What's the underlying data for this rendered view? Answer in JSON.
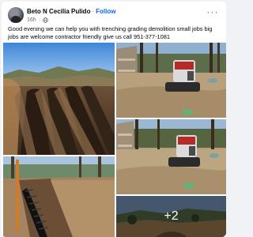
{
  "post": {
    "author": "Beto N Cecilia Pulido",
    "separator": "·",
    "follow_label": "Follow",
    "time": "16h",
    "time_separator": "·",
    "caption": "Good evening we can help you with trenching grading demolition small jobs big jobs are welcome contractor friendly give us call 951-377-1081"
  },
  "photos": {
    "more_count": "+2"
  },
  "icons": {
    "more": "more-options-icon",
    "audience": "globe-icon"
  },
  "colors": {
    "follow": "#0866ff",
    "background": "#f0f2f5",
    "card": "#ffffff",
    "secondary_text": "#65676b"
  }
}
